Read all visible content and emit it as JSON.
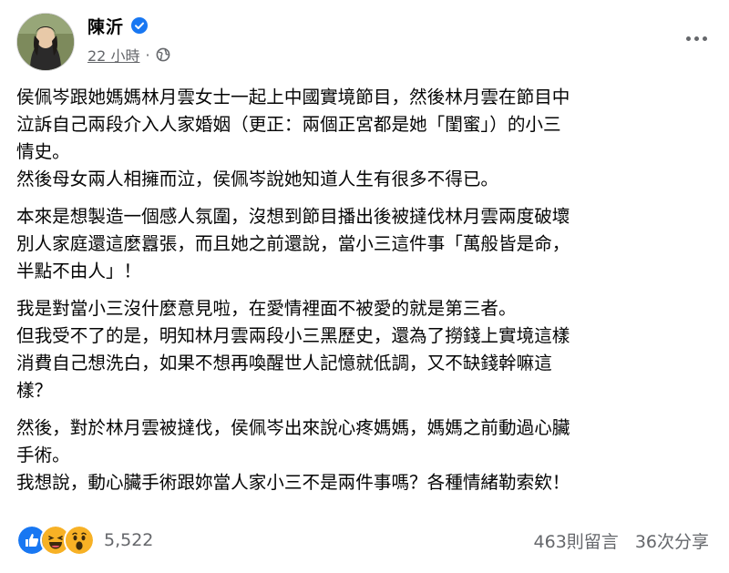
{
  "post": {
    "author": "陳沂",
    "time": "22 小時",
    "separator": "·",
    "paragraphs": [
      [
        "侯佩岑跟她媽媽林月雲女士一起上中國實境節目，然後林月雲在節目中",
        "泣訴自己兩段介入人家婚姻（更正：兩個正宮都是她「閨蜜」）的小三",
        "情史。",
        "然後母女兩人相擁而泣，侯佩岑說她知道人生有很多不得已。"
      ],
      [
        "本來是想製造一個感人氛圍，沒想到節目播出後被撻伐林月雲兩度破壞",
        "別人家庭還這麼囂張，而且她之前還說，當小三這件事「萬般皆是命，",
        "半點不由人」！"
      ],
      [
        "我是對當小三沒什麼意見啦，在愛情裡面不被愛的就是第三者。",
        "但我受不了的是，明知林月雲兩段小三黑歷史，還為了撈錢上實境這樣",
        "消費自己想洗白，如果不想再喚醒世人記憶就低調，又不缺錢幹嘛這",
        "樣？"
      ],
      [
        "然後，對於林月雲被撻伐，侯佩岑出來說心疼媽媽，媽媽之前動過心臟",
        "手術。",
        "我想說，動心臟手術跟妳當人家小三不是兩件事嗎？各種情緒勒索欸！"
      ]
    ]
  },
  "footer": {
    "reaction_count": "5,522",
    "comments": "463則留言",
    "shares": "36次分享"
  },
  "icons": {
    "verified": "verified-badge-icon",
    "privacy": "globe-icon",
    "more": "more-horizontal-icon",
    "reactions": [
      "like-icon",
      "haha-icon",
      "wow-icon"
    ]
  },
  "colors": {
    "verified": "#1877f2",
    "secondary_text": "#65676b",
    "like": "#1877f2",
    "haha_wow": "#f7b125"
  }
}
